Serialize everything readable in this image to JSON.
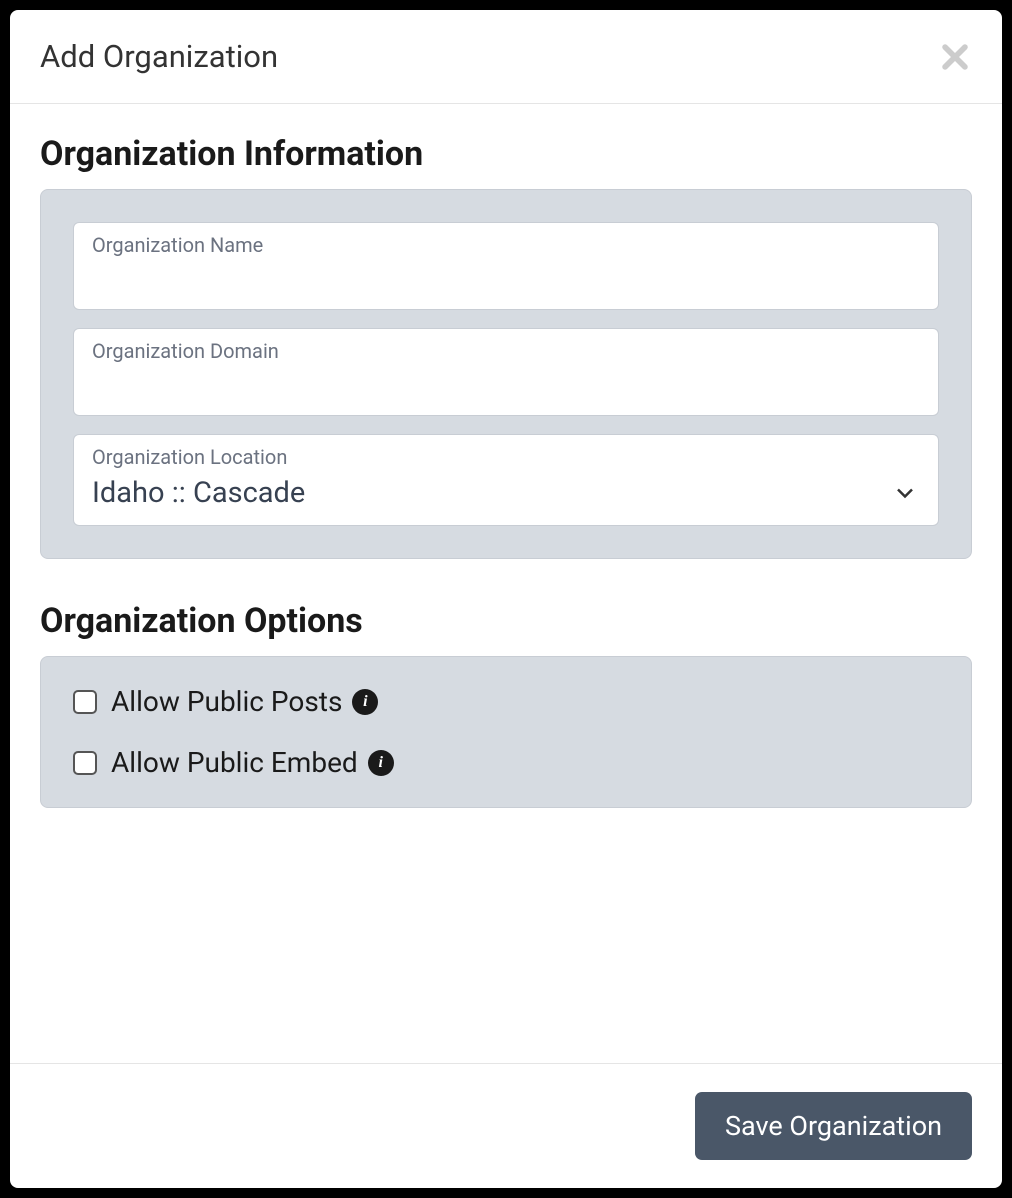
{
  "modal": {
    "title": "Add Organization"
  },
  "sections": {
    "info": {
      "heading": "Organization Information",
      "fields": {
        "name": {
          "label": "Organization Name",
          "value": ""
        },
        "domain": {
          "label": "Organization Domain",
          "value": ""
        },
        "location": {
          "label": "Organization Location",
          "selected": "Idaho :: Cascade"
        }
      }
    },
    "options": {
      "heading": "Organization Options",
      "checkboxes": {
        "public_posts": {
          "label": "Allow Public Posts",
          "checked": false
        },
        "public_embed": {
          "label": "Allow Public Embed",
          "checked": false
        }
      }
    }
  },
  "footer": {
    "save_label": "Save Organization"
  }
}
